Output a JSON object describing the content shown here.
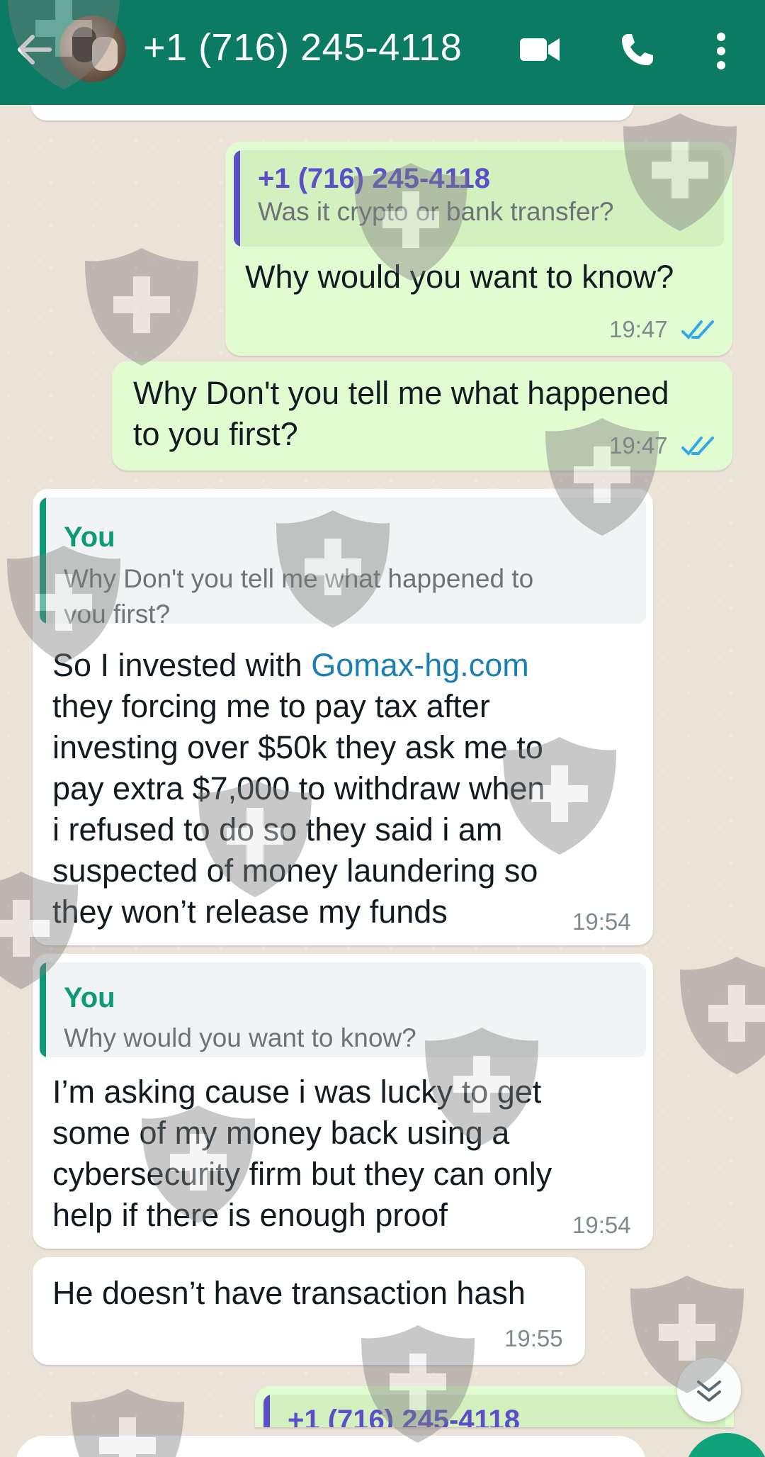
{
  "header": {
    "contact_name": "+1 (716) 245-4118",
    "back_icon": "arrow-left-icon",
    "video_icon": "video-camera-icon",
    "call_icon": "phone-icon",
    "more_icon": "more-vertical-icon",
    "color": "#0b7b63"
  },
  "messages": [
    {
      "direction": "out",
      "quote_name": "+1 (716) 245-4118",
      "quote_text": "Was it crypto or bank transfer?",
      "text": "Why would you want to know?",
      "time": "19:47",
      "status": "read"
    },
    {
      "direction": "out",
      "text_line1": "Why Don't you tell me what happened",
      "text_line2": "to you first?",
      "time": "19:47",
      "status": "read"
    },
    {
      "direction": "in",
      "quote_name": "You",
      "quote_line1": "Why Don't you tell me what happened to",
      "quote_line2": "you first?",
      "text_prefix": "So I invested with ",
      "link": "Gomax-hg.com",
      "lines": [
        "they forcing me to pay tax after",
        "investing over $50k they ask me to",
        "pay extra $7,000 to withdraw when",
        "i refused to do so they said i am",
        "suspected of money laundering so",
        "they won’t release my funds"
      ],
      "time": "19:54"
    },
    {
      "direction": "in",
      "quote_name": "You",
      "quote_text": "Why would you want to know?",
      "lines": [
        "I’m asking cause i was lucky to get",
        "some of my money back using a",
        "cybersecurity firm but they can only",
        "help if there is enough proof"
      ],
      "time": "19:54"
    },
    {
      "direction": "in",
      "text": "He doesn’t have transaction hash",
      "time": "19:55"
    },
    {
      "direction": "out",
      "quote_name": "+1 (716) 245-4118"
    }
  ],
  "colors": {
    "outgoing": "#e2fcd1",
    "incoming": "#ffffff",
    "read_ticks": "#34a8e6",
    "quote_you": "#0b9b76",
    "quote_contact": "#5b4fc9"
  },
  "scroll_down_icon": "double-chevron-down-icon"
}
